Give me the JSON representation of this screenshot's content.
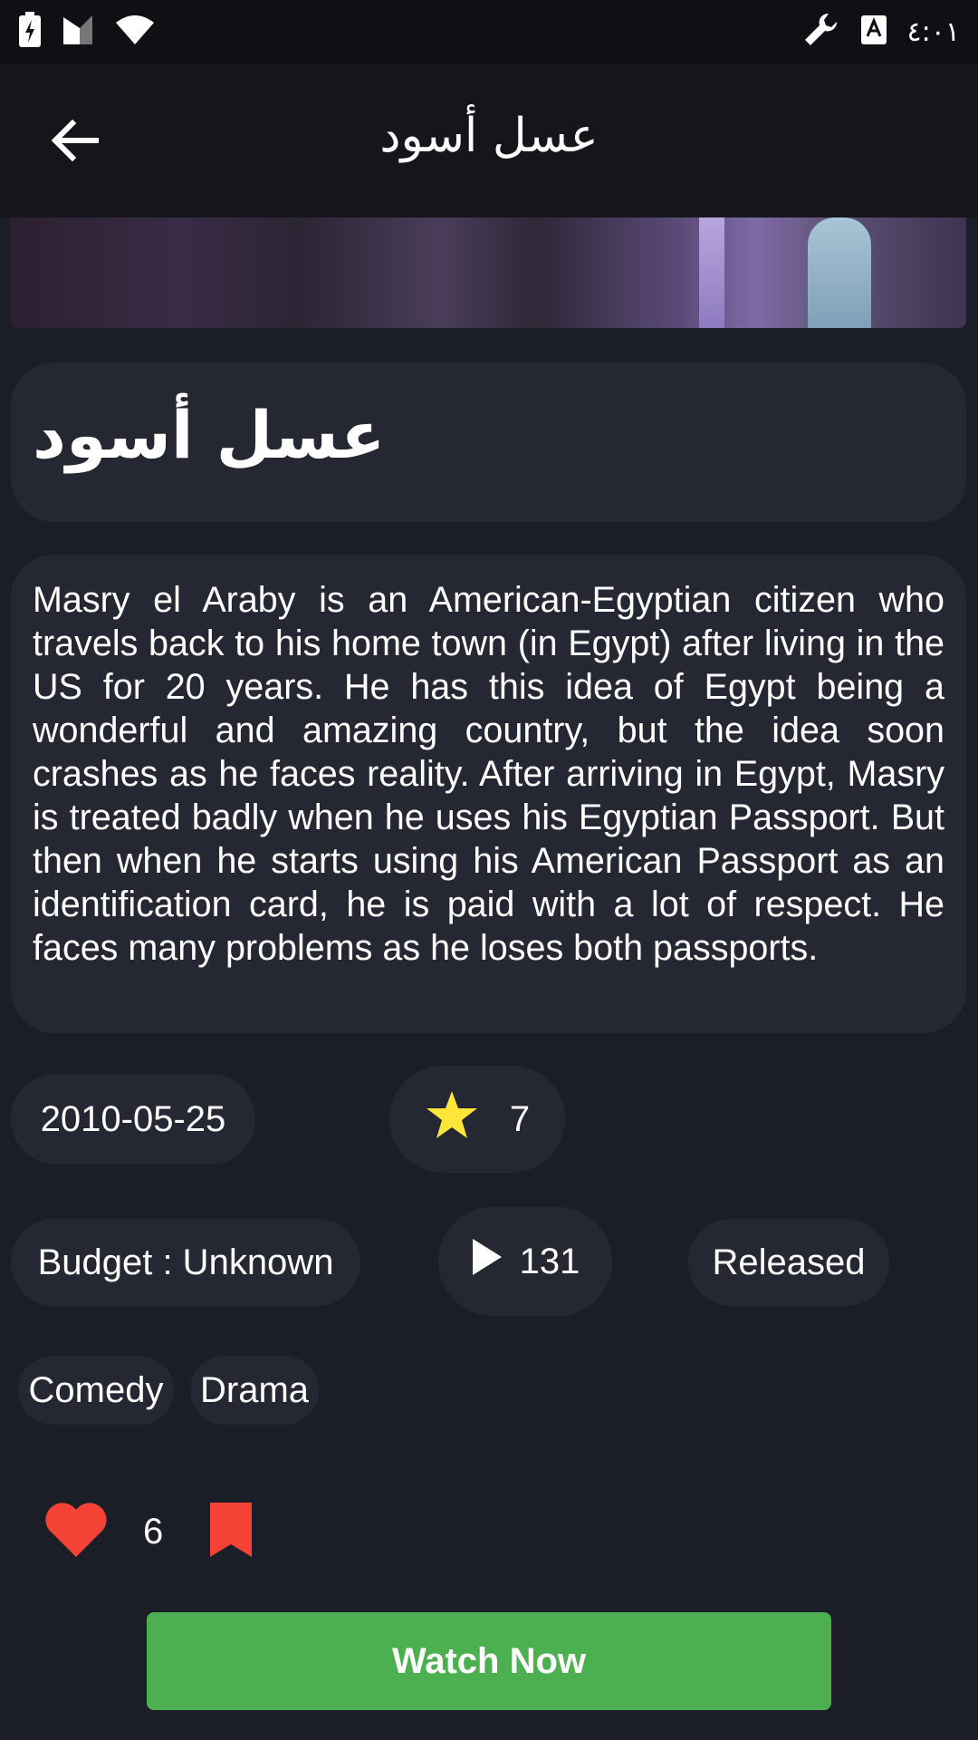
{
  "status_bar": {
    "time": "٤:٠١",
    "icons": [
      "battery-charging-icon",
      "signal-icon",
      "wifi-icon",
      "wrench-icon",
      "keyboard-icon"
    ]
  },
  "app_bar": {
    "title": "عسل أسود",
    "back_icon": "arrow-left-icon"
  },
  "movie": {
    "title": "عسل أسود",
    "overview": "Masry el Araby is an American-Egyptian citizen who travels back to his home town (in Egypt) after living in the US for 20 years. He has this idea of Egypt being a wonderful and amazing country, but the idea soon crashes as he faces reality. After arriving in Egypt, Masry is treated badly when he uses his Egyptian Passport. But then when he starts using his American Passport as an identification card, he is paid with a lot of respect. He faces many problems as he loses both passports.",
    "release_date": "2010-05-25",
    "rating": "7",
    "budget": "Budget : Unknown",
    "vote_count": "131",
    "status": "Released",
    "genres": [
      "Comedy",
      "Drama"
    ]
  },
  "actions": {
    "like_count": "6",
    "watch_label": "Watch Now"
  },
  "colors": {
    "background": "#1c1e27",
    "card": "#252833",
    "star": "#fde53a",
    "heart": "#f44336",
    "bookmark": "#f44336",
    "watch_button": "#4caf50"
  }
}
